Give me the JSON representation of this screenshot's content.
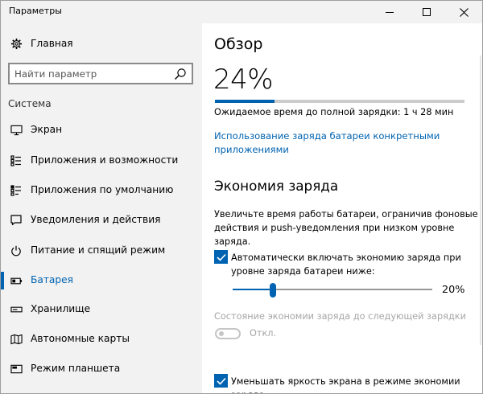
{
  "window": {
    "title": "Параметры"
  },
  "colors": {
    "accent": "#0063b1",
    "sidebar_bg": "#f2f2f2",
    "disabled_text": "#a6a6a6"
  },
  "sidebar": {
    "home": {
      "label": "Главная",
      "icon": "gear-icon"
    },
    "search": {
      "placeholder": "Найти параметр",
      "value": "",
      "icon": "search-icon"
    },
    "section_title": "Система",
    "items": [
      {
        "label": "Экран",
        "icon": "display-icon",
        "active": false
      },
      {
        "label": "Приложения и возможности",
        "icon": "app-list-icon",
        "active": false
      },
      {
        "label": "Приложения по умолчанию",
        "icon": "default-apps-icon",
        "active": false
      },
      {
        "label": "Уведомления и действия",
        "icon": "notification-icon",
        "active": false
      },
      {
        "label": "Питание и спящий режим",
        "icon": "power-icon",
        "active": false
      },
      {
        "label": "Батарея",
        "icon": "battery-icon",
        "active": true
      },
      {
        "label": "Хранилище",
        "icon": "storage-icon",
        "active": false
      },
      {
        "label": "Автономные карты",
        "icon": "map-icon",
        "active": false
      },
      {
        "label": "Режим планшета",
        "icon": "tablet-icon",
        "active": false
      }
    ]
  },
  "main": {
    "overview_title": "Обзор",
    "battery_percent": "24%",
    "battery_level": 0.24,
    "remaining_time": "Ожидаемое время до полной зарядки: 1 ч 28 мин",
    "usage_link": "Использование заряда батареи конкретными приложениями",
    "saver_title": "Экономия заряда",
    "saver_description": "Увеличьте время работы батареи, ограничив фоновые действия и push-уведомления при низком уровне заряда.",
    "auto_saver": {
      "label": "Автоматически включать экономию заряда при уровне заряда батареи ниже:",
      "checked": true
    },
    "threshold": {
      "value_label": "20%",
      "value": 0.2
    },
    "saver_status": {
      "label": "Состояние экономии заряда до следующей зарядки",
      "toggle_text": "Откл.",
      "enabled": false
    },
    "dim_screen": {
      "label": "Уменьшать яркость экрана в режиме экономии заряда",
      "checked": true
    }
  }
}
